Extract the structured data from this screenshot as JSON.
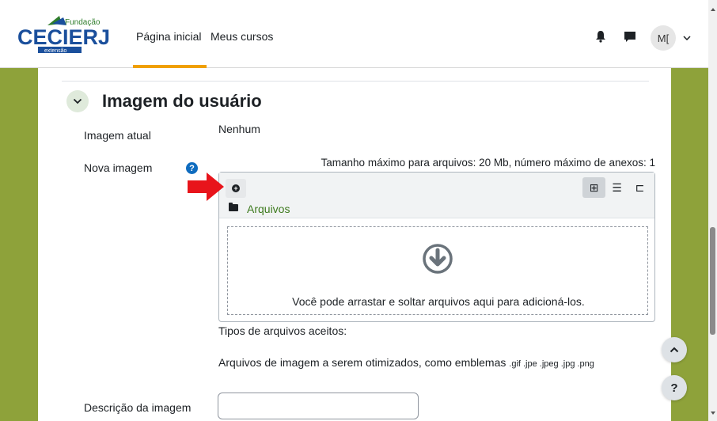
{
  "navbar": {
    "logo": {
      "top_text": "Fundação",
      "main_text": "CECIERJ",
      "sub_text": "extensão"
    },
    "links": {
      "home": "Página inicial",
      "courses": "Meus cursos"
    },
    "user_initials": "M["
  },
  "section": {
    "title": "Imagem do usuário"
  },
  "form": {
    "current_image_label": "Imagem atual",
    "current_image_value": "Nenhum",
    "new_image_label": "Nova imagem",
    "help_symbol": "?",
    "max_info": "Tamanho máximo para arquivos: 20 Mb, número máximo de anexos: 1",
    "filemanager": {
      "add_symbol": "+",
      "folder_label": "Arquivos",
      "view_icons": [
        "grid-view-icon",
        "list-view-icon",
        "tree-view-icon"
      ],
      "view_glyphs": [
        "⊞",
        "☰",
        "⊏"
      ],
      "dropzone_text": "Você pode arrastar e soltar arquivos aqui para adicioná-los."
    },
    "accepted_label": "Tipos de arquivos aceitos:",
    "accepted_desc": "Arquivos de imagem a serem otimizados, como emblemas",
    "accepted_ext": ".gif .jpe .jpeg .jpg .png",
    "description_label": "Descrição da imagem",
    "description_value": ""
  },
  "floating": {
    "back_to_top": "^",
    "help": "?"
  },
  "colors": {
    "accent_green": "#3d7a1e",
    "background_green": "#8ea23a",
    "help_blue": "#0f6cbf",
    "annotation_red": "#e8141b",
    "nav_underline": "#f0a000"
  }
}
